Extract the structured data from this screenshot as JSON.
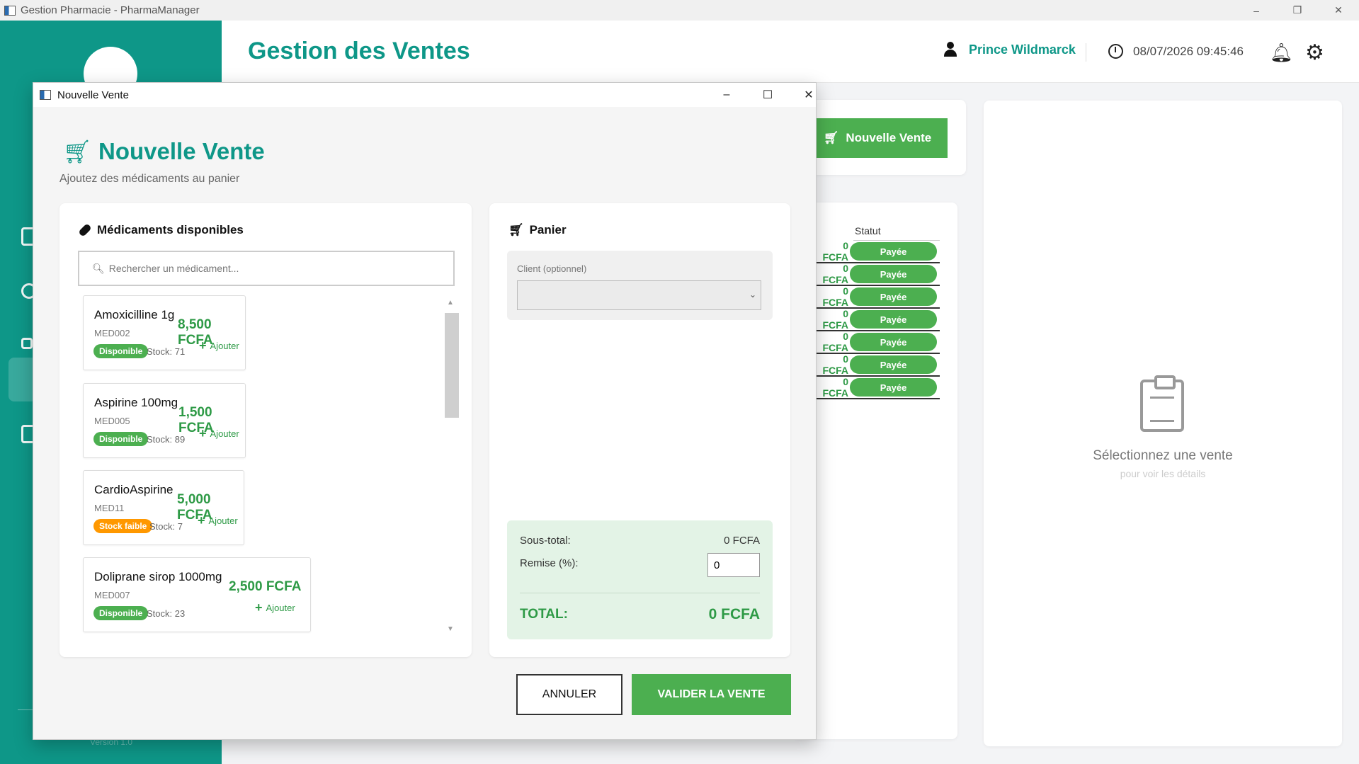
{
  "window": {
    "title": "Gestion Pharmacie - PharmaManager",
    "minimize": "–",
    "maximize": "❐",
    "close": "✕"
  },
  "sidebar": {
    "version": "Version 1.0"
  },
  "header": {
    "title": "Gestion des Ventes",
    "user_name": "Prince Wildmarck",
    "datetime": "08/07/2026 09:45:46",
    "icons": [
      "user-icon",
      "clock-icon",
      "bell-icon",
      "gear-icon"
    ]
  },
  "sales": {
    "new_sale_label": "Nouvelle Vente",
    "status_header": "Statut",
    "rows": [
      {
        "amount": "0 FCFA",
        "status": "Payée"
      },
      {
        "amount": "0 FCFA",
        "status": "Payée"
      },
      {
        "amount": "0 FCFA",
        "status": "Payée"
      },
      {
        "amount": "0 FCFA",
        "status": "Payée"
      },
      {
        "amount": "0 FCFA",
        "status": "Payée"
      },
      {
        "amount": "0 FCFA",
        "status": "Payée"
      },
      {
        "amount": "0 FCFA",
        "status": "Payée"
      }
    ]
  },
  "details": {
    "empty_title": "Sélectionnez une vente",
    "empty_subtitle": "pour voir les détails"
  },
  "dialog": {
    "title": "Nouvelle Vente",
    "heading": "Nouvelle Vente",
    "subheading": "Ajoutez des médicaments au panier",
    "meds": {
      "title": "Médicaments disponibles",
      "search_placeholder": "Rechercher un médicament...",
      "items": [
        {
          "name": "Amoxicilline 1g",
          "code": "MED002",
          "badge": "Disponible",
          "stock": "Stock: 71",
          "price": "8,500 FCFA",
          "add": "Ajouter"
        },
        {
          "name": "Aspirine 100mg",
          "code": "MED005",
          "badge": "Disponible",
          "stock": "Stock: 89",
          "price": "1,500 FCFA",
          "add": "Ajouter"
        },
        {
          "name": "CardioAspirine",
          "code": "MED11",
          "badge": "Stock faible",
          "stock": "Stock: 7",
          "price": "5,000 FCFA",
          "add": "Ajouter"
        },
        {
          "name": "Doliprane sirop 1000mg",
          "code": "MED007",
          "badge": "Disponible",
          "stock": "Stock: 23",
          "price": "2,500 FCFA",
          "add": "Ajouter"
        }
      ]
    },
    "cart": {
      "title": "Panier",
      "client_label": "Client (optionnel)",
      "client_value": "",
      "subtotal_label": "Sous-total:",
      "subtotal_value": "0 FCFA",
      "discount_label": "Remise (%):",
      "discount_value": "0",
      "total_label": "TOTAL:",
      "total_value": "0 FCFA"
    },
    "buttons": {
      "cancel": "ANNULER",
      "validate": "VALIDER LA VENTE"
    }
  },
  "colors": {
    "primary": "#0e9788",
    "success": "#4caf50",
    "warning": "#ff9800",
    "price": "#2e9a46"
  }
}
